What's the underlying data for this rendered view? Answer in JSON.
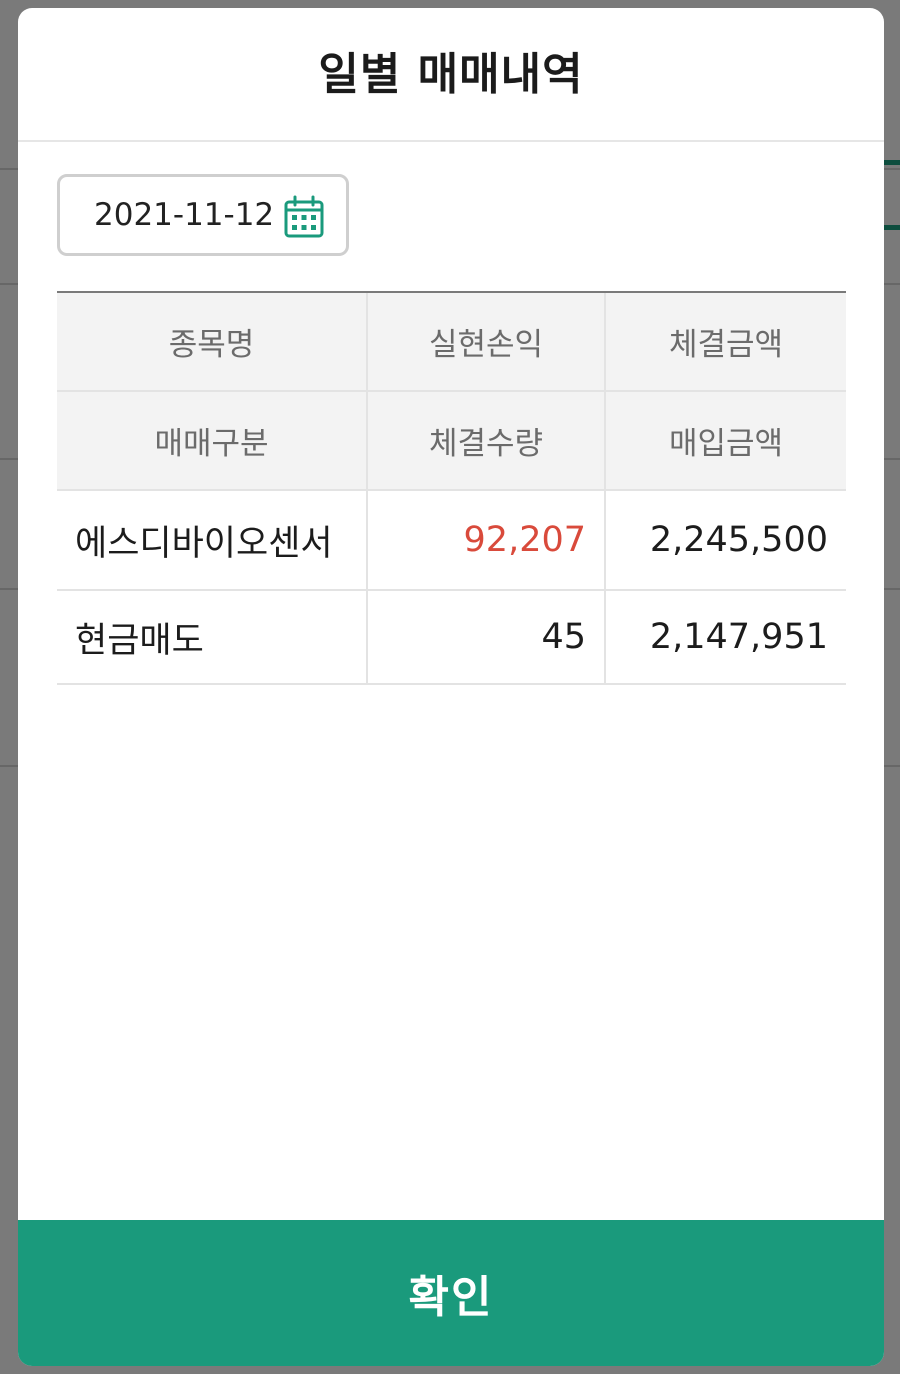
{
  "modal": {
    "title": "일별 매매내역",
    "date": "2021-11-12",
    "confirm_label": "확인"
  },
  "table": {
    "header_rows": [
      [
        "종목명",
        "실현손익",
        "체결금액"
      ],
      [
        "매매구분",
        "체결수량",
        "매입금액"
      ]
    ],
    "rows": [
      [
        "에스디바이오센서",
        "92,207",
        "2,245,500"
      ],
      [
        "현금매도",
        "45",
        "2,147,951"
      ]
    ]
  },
  "colors": {
    "accent": "#1a9a7c",
    "profit": "#d94a3b"
  },
  "icons": {
    "date_picker": "calendar-icon"
  }
}
